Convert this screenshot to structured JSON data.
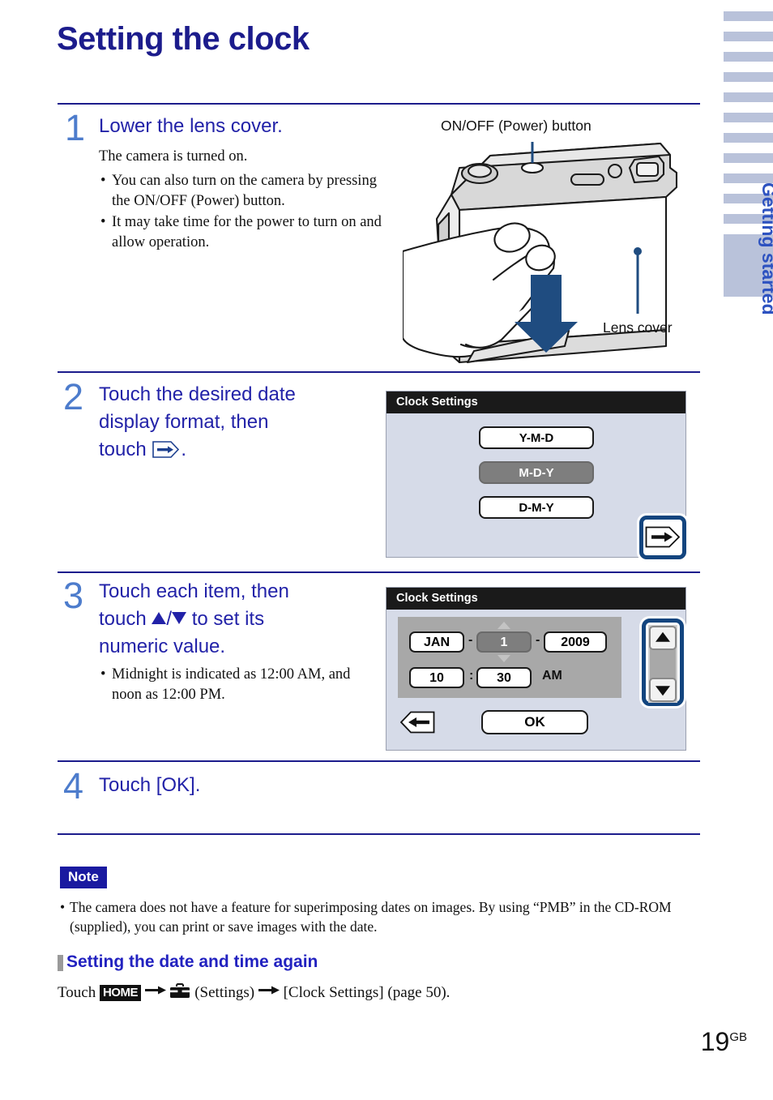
{
  "page": {
    "title": "Setting the clock",
    "number": "19",
    "number_suffix": "GB"
  },
  "sidebar": {
    "label": "Getting started",
    "tab_color": "#b9c2da",
    "label_color": "#2d52c0",
    "tab_count": 11
  },
  "steps": [
    {
      "number": "1",
      "heading": "Lower the lens cover.",
      "body_lead": "The camera is turned on.",
      "bullets": [
        "You can also turn on the camera by pressing the ON/OFF (Power) button.",
        "It may take time for the power to turn on and allow operation."
      ]
    },
    {
      "number": "2",
      "heading_line1": "Touch the desired date",
      "heading_line2": "display format, then",
      "heading_line3_pre": "touch",
      "heading_line3_post": "."
    },
    {
      "number": "3",
      "heading_line1": "Touch each item, then",
      "heading_line2_pre": "touch",
      "heading_line2_mid": "/",
      "heading_line2_post": "to set its",
      "heading_line3": "numeric value.",
      "bullets": [
        "Midnight is indicated as 12:00 AM, and noon as 12:00 PM."
      ]
    },
    {
      "number": "4",
      "heading": "Touch [OK]."
    }
  ],
  "figure": {
    "callout_power": "ON/OFF (Power) button",
    "callout_lens": "Lens cover"
  },
  "lcd_format": {
    "title": "Clock Settings",
    "options": [
      {
        "label": "Y-M-D",
        "selected": false
      },
      {
        "label": "M-D-Y",
        "selected": true
      },
      {
        "label": "D-M-Y",
        "selected": false
      }
    ],
    "next_icon": "arrow-right-icon"
  },
  "lcd_datetime": {
    "title": "Clock Settings",
    "month": "JAN",
    "day": "1",
    "year": "2009",
    "hour": "10",
    "minute": "30",
    "ampm": "AM",
    "date_sep": "-",
    "time_sep": ":",
    "active_field": "day",
    "up_icon": "triangle-up-icon",
    "down_icon": "triangle-down-icon",
    "back_icon": "arrow-left-icon",
    "ok_label": "OK"
  },
  "note": {
    "badge": "Note",
    "text": "The camera does not have a feature for superimposing dates on images. By using “PMB” in the CD-ROM (supplied), you can print or save images with the date."
  },
  "subsection": {
    "heading": "Setting the date and time again",
    "text_parts": {
      "p1": "Touch",
      "home": "HOME",
      "p2": "(Settings)",
      "p3": "[Clock Settings] (page 50)."
    }
  },
  "colors": {
    "title_blue": "#1c1c8c",
    "step_number_blue": "#4d7ccc",
    "step_heading_blue": "#2222a8",
    "highlight_border": "#13457f",
    "lcd_bg": "#d6dbe8",
    "lcd_titlebar": "#1a1a1a",
    "note_badge_bg": "#1a1aa0"
  }
}
